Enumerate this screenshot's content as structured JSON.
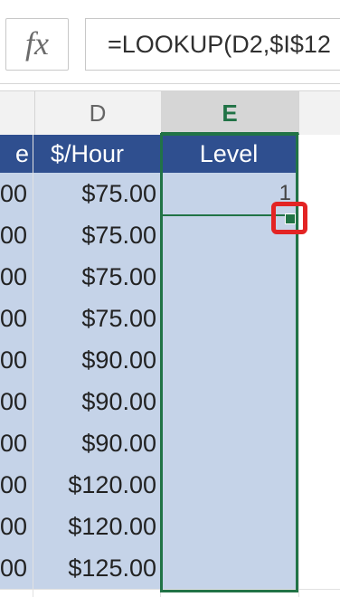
{
  "formula_bar": {
    "fx_label": "fx",
    "formula": "=LOOKUP(D2,$I$12"
  },
  "columns": {
    "d": "D",
    "e": "E"
  },
  "table": {
    "header_c_partial": "e",
    "header_d": "$/Hour",
    "header_e": "Level",
    "rows": [
      {
        "c": "00",
        "d": "$75.00",
        "e": "1"
      },
      {
        "c": "00",
        "d": "$75.00",
        "e": ""
      },
      {
        "c": "00",
        "d": "$75.00",
        "e": ""
      },
      {
        "c": "00",
        "d": "$75.00",
        "e": ""
      },
      {
        "c": "00",
        "d": "$90.00",
        "e": ""
      },
      {
        "c": "00",
        "d": "$90.00",
        "e": ""
      },
      {
        "c": "00",
        "d": "$90.00",
        "e": ""
      },
      {
        "c": "00",
        "d": "$120.00",
        "e": ""
      },
      {
        "c": "00",
        "d": "$120.00",
        "e": ""
      },
      {
        "c": "00",
        "d": "$125.00",
        "e": ""
      }
    ]
  },
  "colors": {
    "header_fill": "#2f4f8f",
    "selection_fill": "#c5d3e8",
    "selection_border": "#217346",
    "callout": "#e32424"
  },
  "icons": {
    "fill_handle": "fill-handle-icon"
  }
}
